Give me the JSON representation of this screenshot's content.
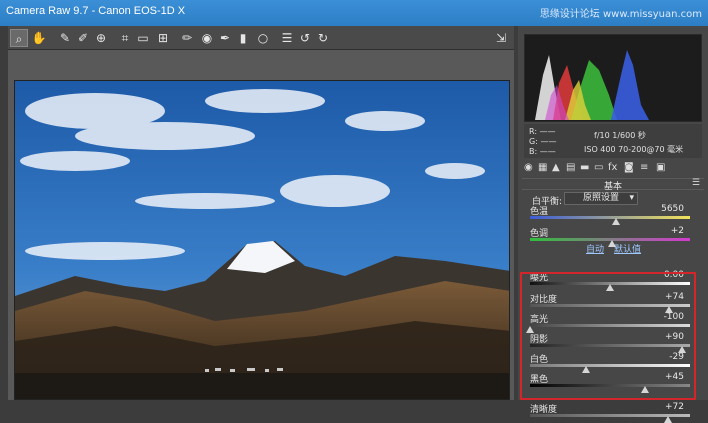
{
  "app": {
    "title": "Camera Raw 9.7  -  Canon EOS-1D X",
    "watermark": "思缘设计论坛 www.missyuan.com"
  },
  "toolbar": {
    "tools": [
      "zoom-icon",
      "hand-icon",
      "white-balance-icon",
      "color-sampler-icon",
      "targeted-adjust-icon",
      "crop-icon",
      "straighten-icon",
      "transform-icon",
      "spot-removal-icon",
      "red-eye-icon",
      "adjustment-brush-icon",
      "graduated-filter-icon",
      "radial-filter-icon",
      "list-icon",
      "rotate-left-icon",
      "rotate-right-icon"
    ],
    "open_icon": "open-object-icon"
  },
  "info": {
    "r": "R:  ——",
    "g": "G:  ——",
    "b": "B:  ——",
    "camera_line1": "f/10   1/600 秒",
    "camera_line2": "ISO 400   70-200@70 毫米"
  },
  "panel": {
    "section_title": "基本",
    "wb_label": "白平衡:",
    "wb_value": "原照设置",
    "auto_label": "自动",
    "default_label": "默认值",
    "sliders": [
      {
        "name": "temp",
        "label": "色温",
        "value": "5650",
        "pos": 0.54
      },
      {
        "name": "tint",
        "label": "色调",
        "value": "+2",
        "pos": 0.51
      },
      {
        "name": "exposure",
        "label": "曝光",
        "value": "0.00",
        "pos": 0.5
      },
      {
        "name": "contrast",
        "label": "对比度",
        "value": "+74",
        "pos": 0.87
      },
      {
        "name": "highlights",
        "label": "高光",
        "value": "-100",
        "pos": 0.0
      },
      {
        "name": "shadows",
        "label": "阴影",
        "value": "+90",
        "pos": 0.95
      },
      {
        "name": "whites",
        "label": "白色",
        "value": "-29",
        "pos": 0.35
      },
      {
        "name": "blacks",
        "label": "黑色",
        "value": "+45",
        "pos": 0.72
      },
      {
        "name": "clarity",
        "label": "清晰度",
        "value": "+72",
        "pos": 0.86
      }
    ]
  },
  "colors": {
    "titlebar": "#2d7fc5",
    "highlight_box": "#d3262b",
    "panel_bg": "#474747"
  }
}
